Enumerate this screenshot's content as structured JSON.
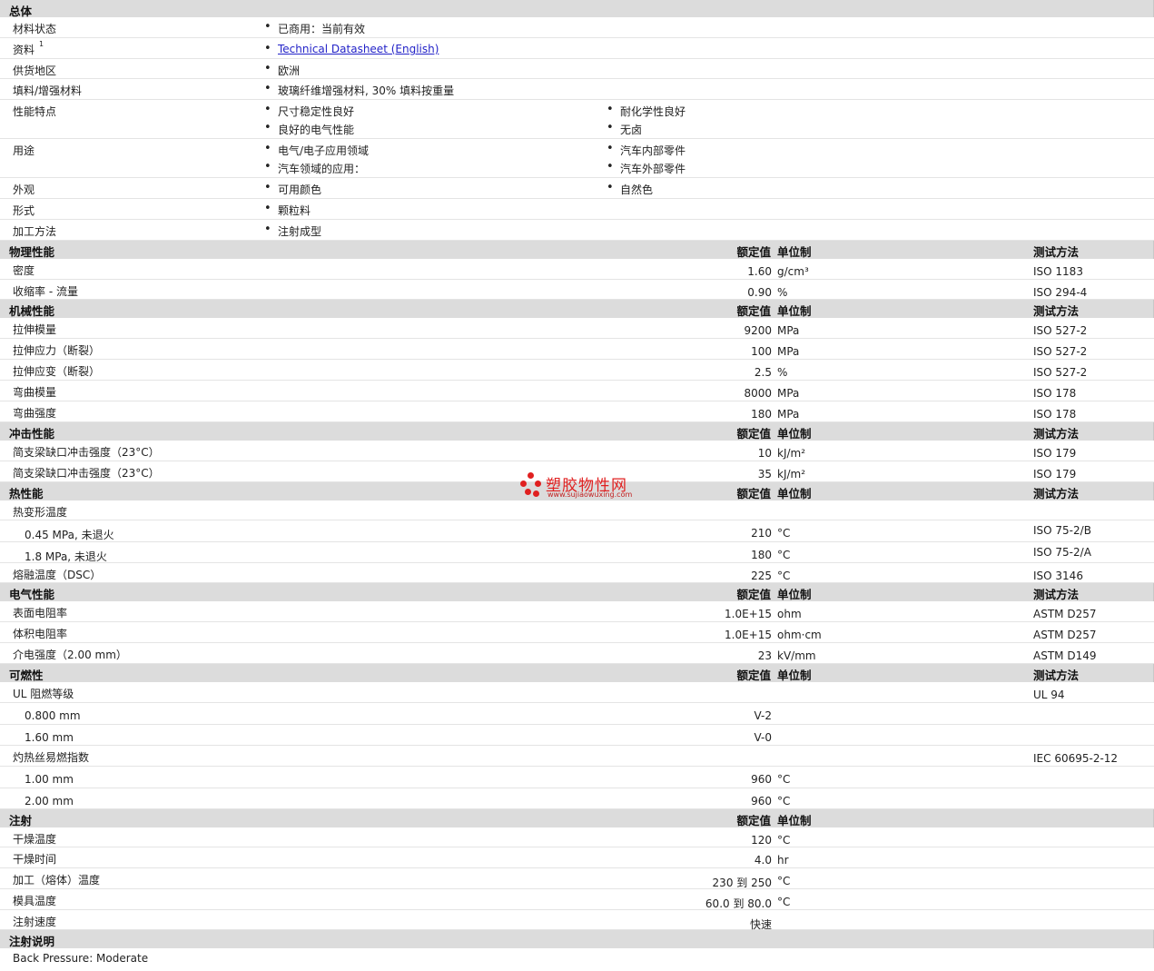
{
  "general": {
    "title": "总体",
    "rows": [
      {
        "label": "材料状态",
        "col1": [
          "已商用：当前有效"
        ],
        "col2": []
      },
      {
        "label": "资料",
        "sup": "1",
        "link": "Technical Datasheet (English)"
      },
      {
        "label": "供货地区",
        "col1": [
          "欧洲"
        ],
        "col2": []
      },
      {
        "label": "填料/增强材料",
        "col1": [
          "玻璃纤维增强材料, 30% 填料按重量"
        ],
        "col2": []
      },
      {
        "label": "性能特点",
        "col1": [
          "尺寸稳定性良好",
          "良好的电气性能"
        ],
        "col2": [
          "耐化学性良好",
          "无卤"
        ]
      },
      {
        "label": "用途",
        "col1": [
          "电气/电子应用领域",
          "汽车领域的应用："
        ],
        "col2": [
          "汽车内部零件",
          "汽车外部零件"
        ]
      },
      {
        "label": "外观",
        "col1": [
          "可用颜色"
        ],
        "col2": [
          "自然色"
        ]
      },
      {
        "label": "形式",
        "col1": [
          "颗粒料"
        ],
        "col2": []
      },
      {
        "label": "加工方法",
        "col1": [
          "注射成型"
        ],
        "col2": []
      }
    ]
  },
  "headers": {
    "nominal": "额定值",
    "unit": "单位制",
    "test": "测试方法"
  },
  "sections": [
    {
      "title": "物理性能",
      "show_test": true,
      "rows": [
        {
          "label": "密度",
          "value": "1.60",
          "unit": "g/cm³",
          "test": "ISO 1183"
        },
        {
          "label": "收缩率  - 流量",
          "value": "0.90",
          "unit": "%",
          "test": "ISO 294-4"
        }
      ]
    },
    {
      "title": "机械性能",
      "show_test": true,
      "rows": [
        {
          "label": "拉伸模量",
          "value": "9200",
          "unit": "MPa",
          "test": "ISO 527-2"
        },
        {
          "label": "拉伸应力（断裂）",
          "value": "100",
          "unit": "MPa",
          "test": "ISO 527-2"
        },
        {
          "label": "拉伸应变（断裂）",
          "value": "2.5",
          "unit": "%",
          "test": "ISO 527-2"
        },
        {
          "label": "弯曲模量",
          "value": "8000",
          "unit": "MPa",
          "test": "ISO 178"
        },
        {
          "label": "弯曲强度",
          "value": "180",
          "unit": "MPa",
          "test": "ISO 178"
        }
      ]
    },
    {
      "title": "冲击性能",
      "show_test": true,
      "rows": [
        {
          "label": "简支梁缺口冲击强度（23°C）",
          "value": "10",
          "unit": "kJ/m²",
          "test": "ISO 179"
        },
        {
          "label": "简支梁缺口冲击强度（23°C）",
          "value": "35",
          "unit": "kJ/m²",
          "test": "ISO 179"
        }
      ]
    },
    {
      "title": "热性能",
      "show_test": true,
      "rows": [
        {
          "label": "热变形温度",
          "value": "",
          "unit": "",
          "test": ""
        },
        {
          "label": "0.45 MPa, 未退火",
          "sub": true,
          "value": "210",
          "unit": "°C",
          "test": "ISO 75-2/B"
        },
        {
          "label": "1.8 MPa, 未退火",
          "sub": true,
          "value": "180",
          "unit": "°C",
          "test": "ISO 75-2/A"
        },
        {
          "label": "熔融温度（DSC）",
          "value": "225",
          "unit": "°C",
          "test": "ISO 3146"
        }
      ]
    },
    {
      "title": "电气性能",
      "show_test": true,
      "rows": [
        {
          "label": "表面电阻率",
          "value": "1.0E+15",
          "unit": "ohm",
          "test": "ASTM D257"
        },
        {
          "label": "体积电阻率",
          "value": "1.0E+15",
          "unit": "ohm·cm",
          "test": "ASTM D257"
        },
        {
          "label": "介电强度（2.00 mm）",
          "value": "23",
          "unit": "kV/mm",
          "test": "ASTM D149"
        }
      ]
    },
    {
      "title": "可燃性",
      "show_test": true,
      "rows": [
        {
          "label": "UL 阻燃等级",
          "value": "",
          "unit": "",
          "test": "UL 94"
        },
        {
          "label": "0.800 mm",
          "sub": true,
          "value": "V-2",
          "unit": "",
          "test": ""
        },
        {
          "label": "1.60 mm",
          "sub": true,
          "value": "V-0",
          "unit": "",
          "test": ""
        },
        {
          "label": "灼热丝易燃指数",
          "value": "",
          "unit": "",
          "test": "IEC 60695-2-12"
        },
        {
          "label": "1.00 mm",
          "sub": true,
          "value": "960",
          "unit": "°C",
          "test": ""
        },
        {
          "label": "2.00 mm",
          "sub": true,
          "value": "960",
          "unit": "°C",
          "test": ""
        }
      ]
    },
    {
      "title": "注射",
      "show_test": false,
      "rows": [
        {
          "label": "干燥温度",
          "value": "120",
          "unit": "°C",
          "test": ""
        },
        {
          "label": "干燥时间",
          "value": "4.0",
          "unit": "hr",
          "test": ""
        },
        {
          "label": "加工（熔体）温度",
          "value": "230 到  250",
          "unit": "°C",
          "test": ""
        },
        {
          "label": "模具温度",
          "value": "60.0 到  80.0",
          "unit": "°C",
          "test": ""
        },
        {
          "label": "注射速度",
          "value": "快速",
          "unit": "",
          "test": ""
        }
      ]
    }
  ],
  "notes": {
    "title": "注射说明",
    "text": "Back Pressure: Moderate"
  },
  "watermark": {
    "text": "塑胶物性网",
    "url": "www.sujiaowuxing.com",
    "color": "#e02020"
  }
}
